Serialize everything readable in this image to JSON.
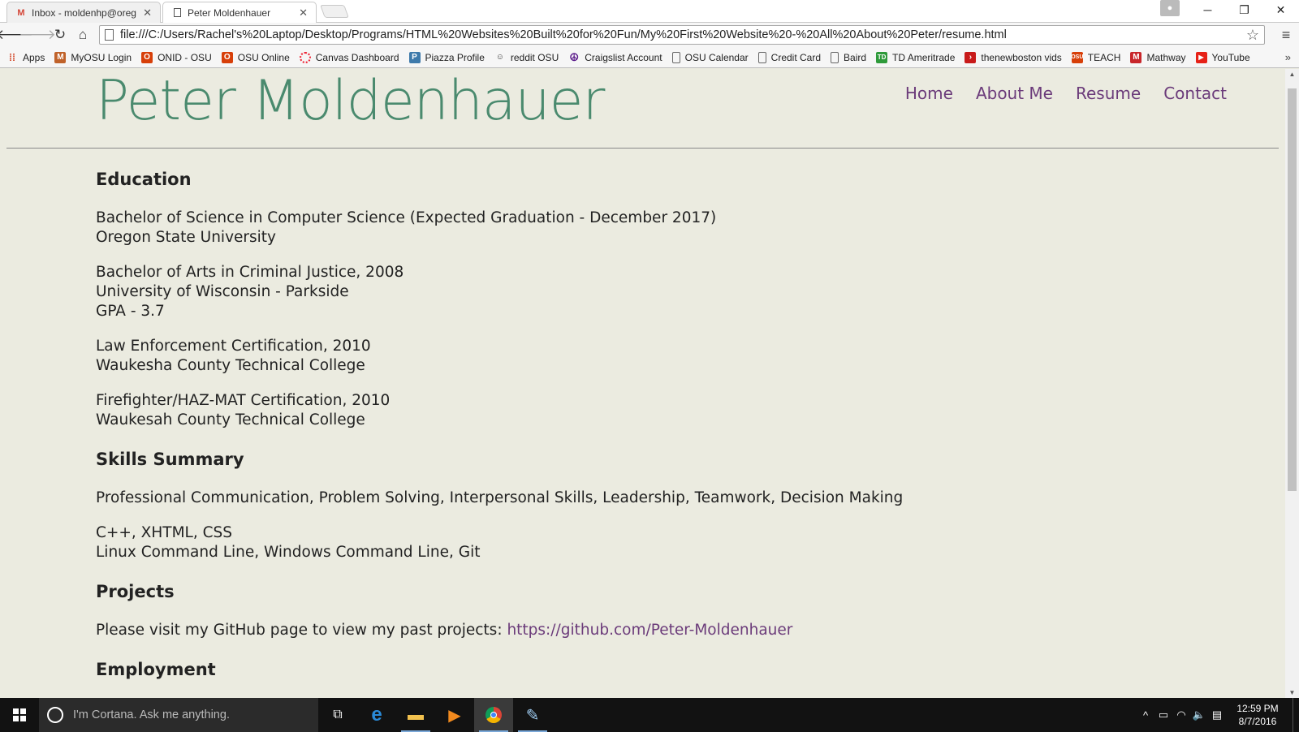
{
  "browser": {
    "tabs": [
      {
        "title": "Inbox - moldenhp@oreg",
        "favicon": "gmail-icon",
        "active": false
      },
      {
        "title": "Peter Moldenhauer",
        "favicon": "page-icon",
        "active": true
      }
    ],
    "url": "file:///C:/Users/Rachel's%20Laptop/Desktop/Programs/HTML%20Websites%20Built%20for%20Fun/My%20First%20Website%20-%20All%20About%20Peter/resume.html",
    "bookmarks": [
      {
        "label": "Apps",
        "icon": "apps-grid-icon"
      },
      {
        "label": "MyOSU Login",
        "icon": "osu-icon"
      },
      {
        "label": "ONID - OSU",
        "icon": "osu-icon"
      },
      {
        "label": "OSU Online",
        "icon": "osu-icon"
      },
      {
        "label": "Canvas Dashboard",
        "icon": "canvas-icon"
      },
      {
        "label": "Piazza Profile",
        "icon": "piazza-icon"
      },
      {
        "label": "reddit OSU",
        "icon": "reddit-icon"
      },
      {
        "label": "Craigslist Account",
        "icon": "peace-icon"
      },
      {
        "label": "OSU Calendar",
        "icon": "page-icon"
      },
      {
        "label": "Credit Card",
        "icon": "page-icon"
      },
      {
        "label": "Baird",
        "icon": "page-icon"
      },
      {
        "label": "TD Ameritrade",
        "icon": "td-icon"
      },
      {
        "label": "thenewboston vids",
        "icon": "newboston-icon"
      },
      {
        "label": "TEACH",
        "icon": "osu-coe-icon"
      },
      {
        "label": "Mathway",
        "icon": "mathway-icon"
      },
      {
        "label": "YouTube",
        "icon": "youtube-icon"
      }
    ]
  },
  "site": {
    "title": "Peter Moldenhauer",
    "nav": [
      "Home",
      "About Me",
      "Resume",
      "Contact"
    ]
  },
  "resume": {
    "education_heading": "Education",
    "edu1_line1": "Bachelor of Science in Computer Science (Expected Graduation - December 2017)",
    "edu1_line2": "Oregon State University",
    "edu2_line1": "Bachelor of Arts in Criminal Justice, 2008",
    "edu2_line2": "University of Wisconsin - Parkside",
    "edu2_line3": "GPA - 3.7",
    "edu3_line1": "Law Enforcement Certification, 2010",
    "edu3_line2": "Waukesha County Technical College",
    "edu4_line1": "Firefighter/HAZ-MAT Certification, 2010",
    "edu4_line2": "Waukesah County Technical College",
    "skills_heading": "Skills Summary",
    "skills1": "Professional Communication, Problem Solving, Interpersonal Skills, Leadership, Teamwork, Decision Making",
    "skills2_line1": "C++, XHTML, CSS",
    "skills2_line2": "Linux Command Line, Windows Command Line, Git",
    "projects_heading": "Projects",
    "projects_text": "Please visit my GitHub page to view my past projects: ",
    "projects_link": "https://github.com/Peter-Moldenhauer",
    "employment_heading": "Employment"
  },
  "taskbar": {
    "search_placeholder": "I'm Cortana. Ask me anything.",
    "time": "12:59 PM",
    "date": "8/7/2016"
  },
  "colors": {
    "page_bg": "#ebebe0",
    "title_green": "#4a8a6e",
    "link_purple": "#6b3b7a"
  }
}
